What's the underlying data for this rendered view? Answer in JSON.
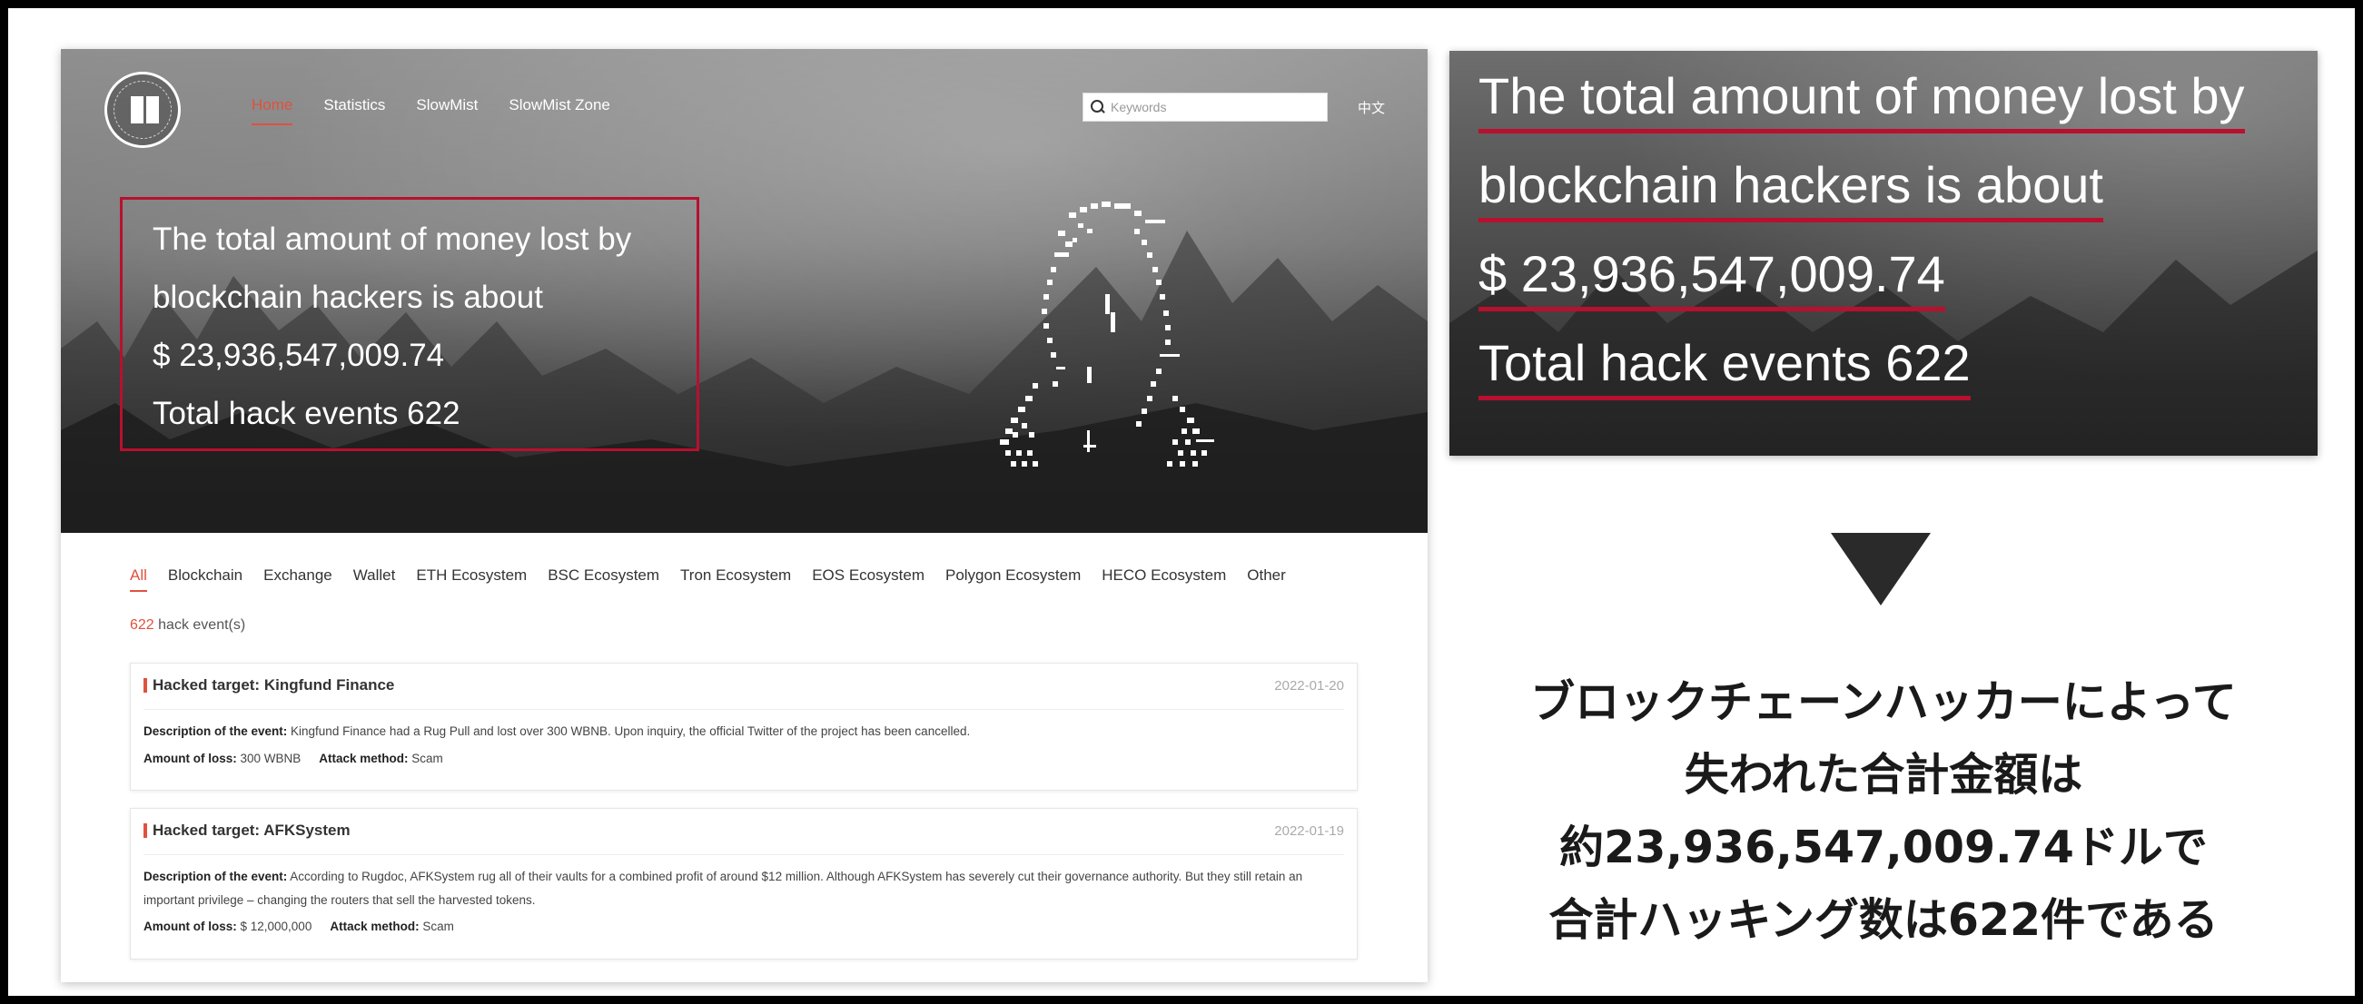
{
  "site": {
    "nav": [
      "Home",
      "Statistics",
      "SlowMist",
      "SlowMist Zone"
    ],
    "active_nav": "Home",
    "search_placeholder": "Keywords",
    "language_toggle": "中文",
    "hero_stats": {
      "line1": "The total amount of money lost by",
      "line2": "blockchain hackers is about",
      "amount": "$ 23,936,547,009.74",
      "events": "Total hack events 622"
    },
    "tabs": [
      "All",
      "Blockchain",
      "Exchange",
      "Wallet",
      "ETH Ecosystem",
      "BSC Ecosystem",
      "Tron Ecosystem",
      "EOS Ecosystem",
      "Polygon Ecosystem",
      "HECO Ecosystem",
      "Other"
    ],
    "active_tab": "All",
    "event_count": {
      "number": "622",
      "suffix": " hack event(s)"
    },
    "events": [
      {
        "title": "Hacked target: Kingfund Finance",
        "date": "2022-01-20",
        "description_label": "Description of the event:",
        "description": " Kingfund Finance had a Rug Pull and lost over 300 WBNB. Upon inquiry, the official Twitter of the project has been cancelled.",
        "loss_label": "Amount of loss:",
        "loss": " 300 WBNB",
        "method_label": "Attack method:",
        "method": " Scam"
      },
      {
        "title": "Hacked target: AFKSystem",
        "date": "2022-01-19",
        "description_label": "Description of the event:",
        "description": " According to Rugdoc, AFKSystem rug all of their vaults for a combined profit of around $12 million. Although AFKSystem has severely cut their governance authority. But they still retain an important privilege – changing the routers that sell the harvested tokens.",
        "loss_label": "Amount of loss:",
        "loss": " $ 12,000,000",
        "method_label": "Attack method:",
        "method": " Scam"
      }
    ]
  },
  "zoom": {
    "line1": "The total amount of money lost by",
    "line2": "blockchain hackers is about",
    "amount": "$ 23,936,547,009.74",
    "events": "Total hack events 622"
  },
  "japanese": {
    "line1": "ブロックチェーンハッカーによって",
    "line2": "失われた合計金額は",
    "line3": "約23,936,547,009.74ドルで",
    "line4": "合計ハッキング数は622件である"
  },
  "colors": {
    "accent": "#e0513f",
    "highlight_border": "#b8102e"
  }
}
